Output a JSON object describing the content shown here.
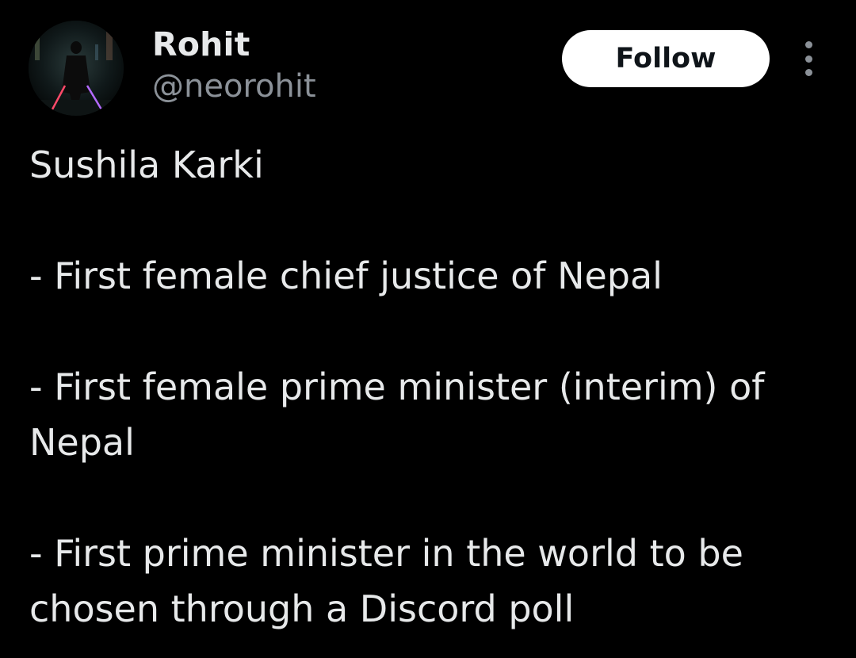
{
  "author": {
    "name": "Rohit",
    "handle": "@neorohit"
  },
  "actions": {
    "follow_label": "Follow",
    "more_icon": "more-vertical-icon"
  },
  "tweet": {
    "line1": "Sushila Karki",
    "line2": "- First female chief justice of Nepal",
    "line3a": "- First female prime minister (interim) of",
    "line3b": "Nepal",
    "line4a": "- First prime minister in the world to be",
    "line4b": "chosen through a Discord poll"
  },
  "colors": {
    "background": "#000000",
    "text": "#e7e9ea",
    "secondary_text": "#8b9198",
    "follow_button_bg": "#ffffff",
    "follow_button_text": "#0f1419"
  }
}
